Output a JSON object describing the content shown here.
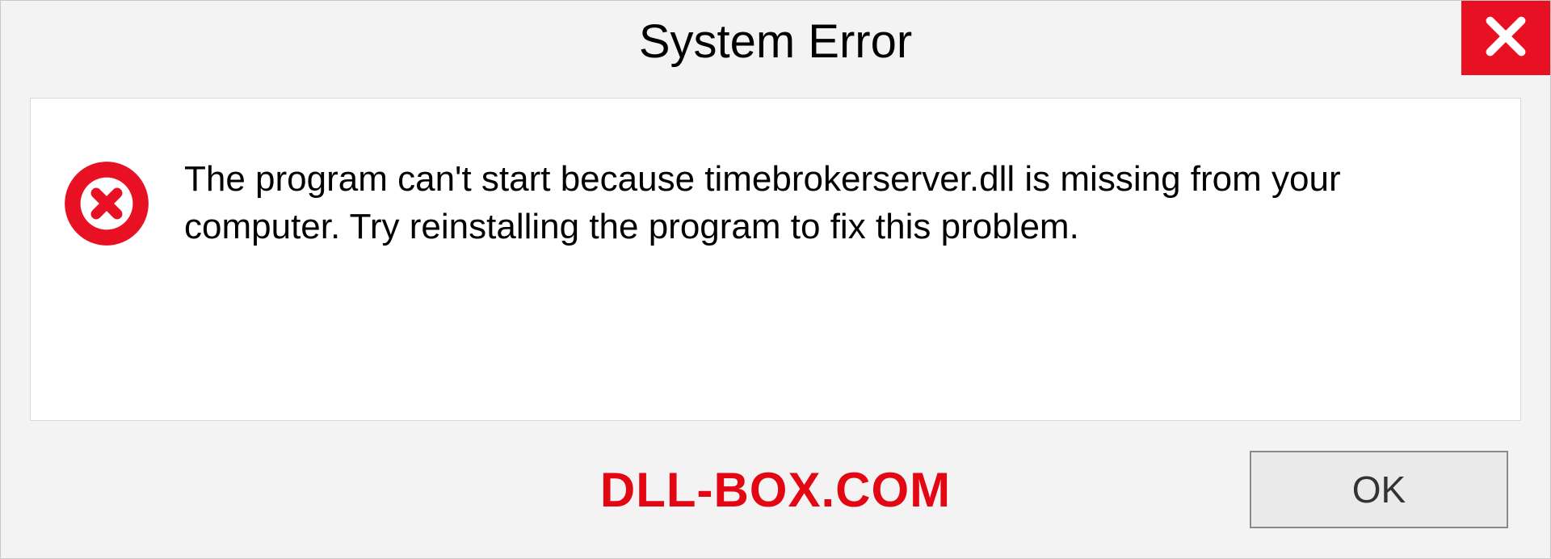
{
  "dialog": {
    "title": "System Error",
    "message": "The program can't start because timebrokerserver.dll is missing from your computer. Try reinstalling the program to fix this problem.",
    "ok_label": "OK",
    "watermark": "DLL-BOX.COM"
  }
}
